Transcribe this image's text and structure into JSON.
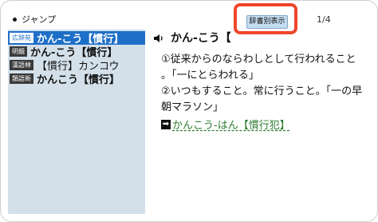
{
  "jump_label": "ジャンプ",
  "dict_button_label": "辞書別表示",
  "page_indicator": "1/4",
  "sidebar": {
    "items": [
      {
        "badge": "広辞苑",
        "label": "かん‐こう【慣行】",
        "selected": true
      },
      {
        "badge": "明鏡",
        "label": "かん‐こう【慣行】",
        "selected": false
      },
      {
        "badge": "漢語林",
        "label": "【慣行】カンコウ",
        "selected": false
      },
      {
        "badge": "類語新",
        "label": "かんこう【慣行】",
        "selected": false
      }
    ]
  },
  "entry": {
    "headword": "かん‐こう【",
    "definition_lines": [
      "①従来からのならわしとして行われること",
      "。「一にとらわれる」",
      "②いつもすること。常に行うこと。「一の早",
      "朝マラソン」"
    ],
    "link_text": "かんこう‐はん【慣行犯】"
  },
  "colors": {
    "accent": "#1e6fc8",
    "highlight": "#f0462c",
    "sidebar_bg": "#d3e0ea",
    "link": "#2e7d32"
  }
}
